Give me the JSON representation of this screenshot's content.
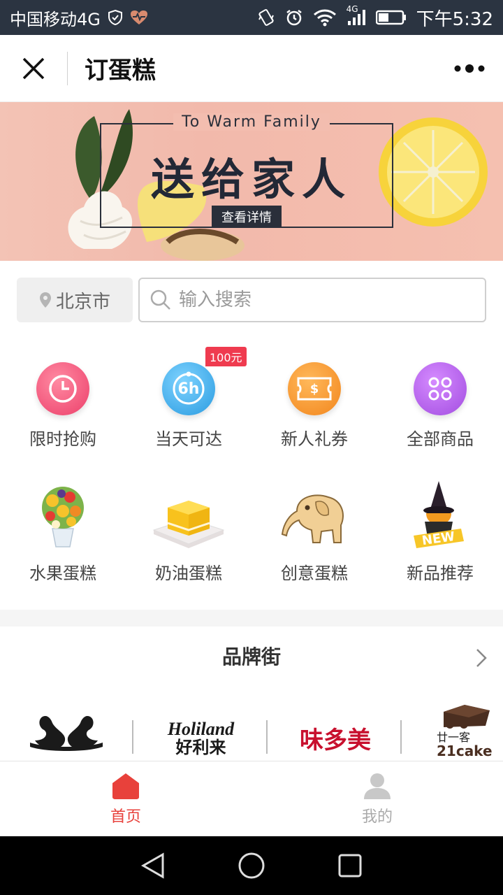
{
  "status_bar": {
    "carrier": "中国移动4G",
    "network": "4G",
    "time": "下午5:32"
  },
  "titlebar": {
    "title": "订蛋糕"
  },
  "banner": {
    "subtitle": "To Warm Family",
    "headline": "送给家人",
    "button": "查看详情"
  },
  "search": {
    "city": "北京市",
    "placeholder": "输入搜索"
  },
  "quick_actions": [
    {
      "label": "限时抢购",
      "icon": "clock-icon",
      "color": "#f2557a"
    },
    {
      "label": "当天可达",
      "icon": "6h-icon",
      "color": "#2fa8ea",
      "icon_text": "6h"
    },
    {
      "label": "新人礼券",
      "icon": "coupon-icon",
      "color": "#f7932d",
      "badge": "100元"
    },
    {
      "label": "全部商品",
      "icon": "grid-dots-icon",
      "color": "#b05be6"
    }
  ],
  "categories": [
    {
      "label": "水果蛋糕",
      "icon": "fruit-bouquet-image"
    },
    {
      "label": "奶油蛋糕",
      "icon": "mango-cake-image"
    },
    {
      "label": "创意蛋糕",
      "icon": "elephant-cookie-image"
    },
    {
      "label": "新品推荐",
      "icon": "witch-hat-cake-image",
      "tag": "NEW"
    }
  ],
  "brand_street": {
    "title": "品牌街",
    "brands": [
      {
        "name": "Black Swan Luxury",
        "icon": "black-swan-logo"
      },
      {
        "name_en": "Holiland",
        "name_cn": "好利来"
      },
      {
        "name": "味多美"
      },
      {
        "name_cn": "廿一客",
        "name_en": "21cake"
      }
    ]
  },
  "bottom_nav": {
    "home": "首页",
    "me": "我的",
    "active_color": "#e8413b"
  }
}
